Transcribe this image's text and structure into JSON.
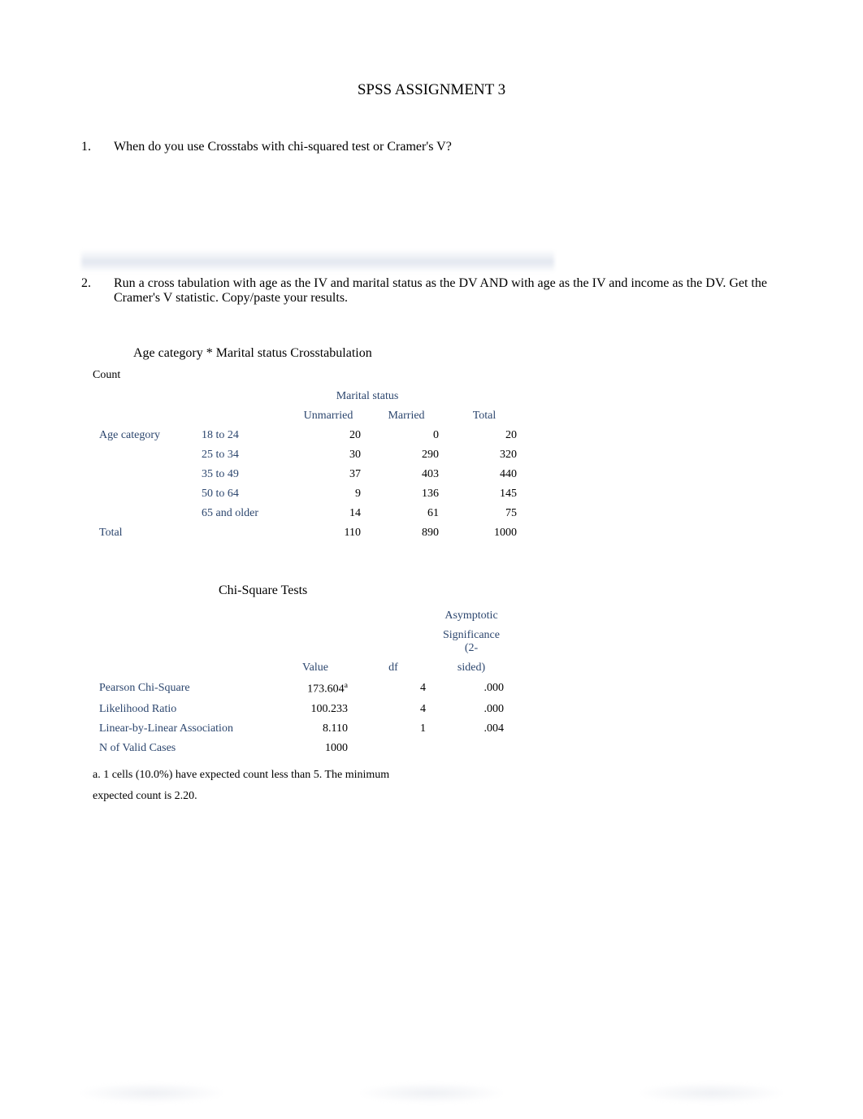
{
  "title": "SPSS ASSIGNMENT 3",
  "questions": {
    "q1": {
      "num": "1.",
      "text": "When do you use Crosstabs   with chi-squared test or Cramer's V?"
    },
    "q2": {
      "num": "2.",
      "text": "Run a cross tabulation with age as the IV and marital status as the DV AND with age as the IV and income as the DV. Get the Cramer's V statistic. Copy/paste your results."
    }
  },
  "crosstab": {
    "title": "Age category * Marital status Crosstabulation",
    "count_label": "Count",
    "group_header": "Marital status",
    "col_headers": {
      "c1": "Unmarried",
      "c2": "Married",
      "c3": "Total"
    },
    "row_group_label": "Age category",
    "rows": [
      {
        "label": "18 to 24",
        "unmarried": "20",
        "married": "0",
        "total": "20"
      },
      {
        "label": "25 to 34",
        "unmarried": "30",
        "married": "290",
        "total": "320"
      },
      {
        "label": "35 to 49",
        "unmarried": "37",
        "married": "403",
        "total": "440"
      },
      {
        "label": "50 to 64",
        "unmarried": "9",
        "married": "136",
        "total": "145"
      },
      {
        "label": "65 and older",
        "unmarried": "14",
        "married": "61",
        "total": "75"
      }
    ],
    "total_row": {
      "label": "Total",
      "unmarried": "110",
      "married": "890",
      "total": "1000"
    }
  },
  "chisq": {
    "title": "Chi-Square Tests",
    "head": {
      "value": "Value",
      "df": "df",
      "sig1": "Asymptotic",
      "sig2": "Significance (2-",
      "sig3": "sided)"
    },
    "rows": [
      {
        "label": "Pearson Chi-Square",
        "value": "173.604",
        "sup": "a",
        "df": "4",
        "sig": ".000"
      },
      {
        "label": "Likelihood Ratio",
        "value": "100.233",
        "sup": "",
        "df": "4",
        "sig": ".000"
      },
      {
        "label": "Linear-by-Linear Association",
        "value": "8.110",
        "sup": "",
        "df": "1",
        "sig": ".004"
      },
      {
        "label": "N of Valid Cases",
        "value": "1000",
        "sup": "",
        "df": "",
        "sig": ""
      }
    ],
    "footnote_a": "a. 1 cells (10.0%) have expected count less than 5. The minimum",
    "footnote_b": "expected count is 2.20."
  }
}
